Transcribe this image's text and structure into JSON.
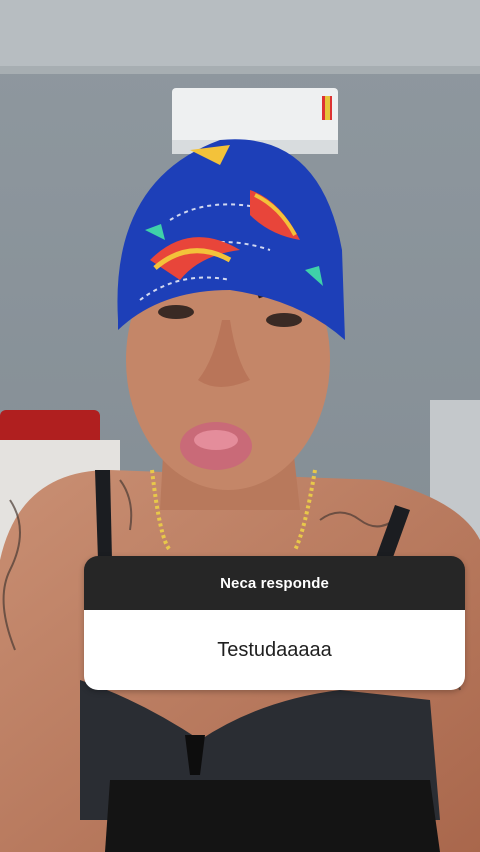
{
  "question_sticker": {
    "header": "Neca responde",
    "answer": "Testudaaaaa"
  },
  "colors": {
    "wall": "#8a949c",
    "cap": "#1d3fb8",
    "card_header": "#262626",
    "card_body": "#ffffff"
  }
}
